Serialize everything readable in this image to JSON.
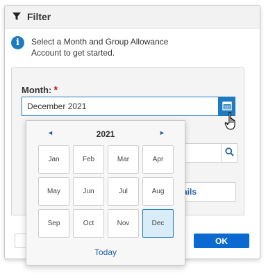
{
  "dialog": {
    "title": "Filter",
    "info_text": "Select a Month and Group Allowance Account to get started.",
    "month_label": "Month:",
    "required_marker": "*",
    "month_value": "December 2021",
    "details_button_partial": "ails",
    "ok_label": "OK"
  },
  "picker": {
    "year": "2021",
    "prev_glyph": "◄",
    "next_glyph": "►",
    "months": [
      "Jan",
      "Feb",
      "Mar",
      "Apr",
      "May",
      "Jun",
      "Jul",
      "Aug",
      "Sep",
      "Oct",
      "Nov",
      "Dec"
    ],
    "selected_month": "Dec",
    "today_label": "Today"
  },
  "icons": {
    "header": "funnel-icon",
    "info": "info-icon",
    "calendar": "calendar-icon",
    "search": "search-icon",
    "cursor": "hand-pointer-icon"
  },
  "colors": {
    "accent": "#1f7bc0",
    "ok_button": "#0a6ad1",
    "required": "#c0161b",
    "selected_month_bg": "#d9ecf8"
  }
}
